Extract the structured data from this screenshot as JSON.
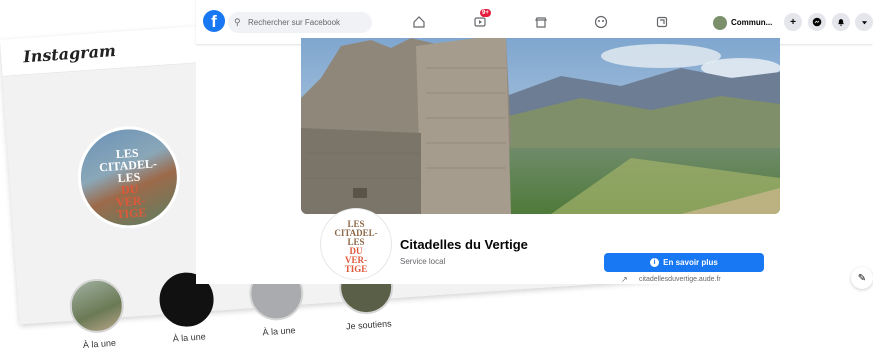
{
  "instagram": {
    "logo": "Instagram",
    "brand_lines": [
      "LES",
      "CITADEL-",
      "LES",
      "DU",
      "VER-",
      "TIGE"
    ],
    "highlights": [
      {
        "label": "À la une"
      },
      {
        "label": "À la une"
      },
      {
        "label": "À la une"
      },
      {
        "label": "Je soutiens"
      }
    ]
  },
  "facebook": {
    "search_placeholder": "Rechercher sur Facebook",
    "notification_badge": "9+",
    "user_label": "Commun...",
    "page_name": "Citadelles du Vertige",
    "page_category": "Service local",
    "cta_label": "En savoir plus",
    "website": "citadellesduvertige.aude.fr",
    "brand_color": "#1877f2",
    "icons": [
      "facebook-logo-icon",
      "search-icon",
      "home-icon",
      "video-icon",
      "marketplace-icon",
      "groups-icon",
      "gaming-icon",
      "plus-icon",
      "messenger-icon",
      "bell-icon",
      "caret-down-icon",
      "info-icon",
      "external-link-icon",
      "edit-icon"
    ]
  }
}
